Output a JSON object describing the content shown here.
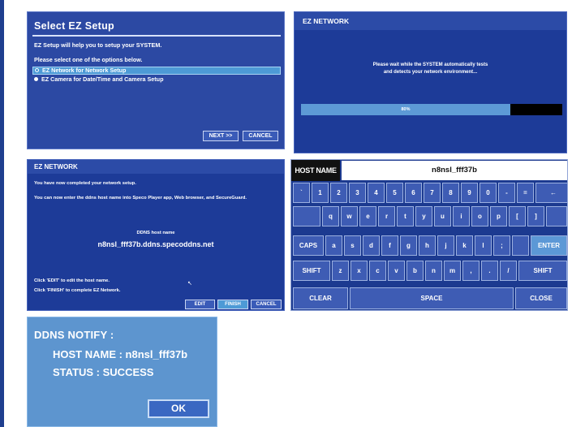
{
  "select_ez_setup": {
    "title": "Select EZ Setup",
    "desc1": "EZ Setup will help you to setup your SYSTEM.",
    "desc2": "Please select one of the options below.",
    "options": [
      {
        "label": "EZ Network for Network Setup",
        "selected": true
      },
      {
        "label": "EZ Camera for Date/Time and Camera Setup",
        "selected": false
      }
    ],
    "next_label": "NEXT >>",
    "cancel_label": "CANCEL"
  },
  "ez_network_progress": {
    "title": "EZ NETWORK",
    "wait_line1": "Please wait while the SYSTEM automatically tests",
    "wait_line2": "and detects your network environment...",
    "progress_label": "80%",
    "progress_value": 0.8
  },
  "ez_network_done": {
    "title": "EZ NETWORK",
    "line1": "You have now completed your network setup.",
    "line2": "You can now enter the ddns host name into Speco Player app, Web browser, and SecureGuard.",
    "ddns_label": "DDNS host name",
    "ddns_value": "n8nsl_fff37b.ddns.specoddns.net",
    "hint_edit": "Click 'EDIT' to edit the host name.",
    "hint_finish": "Click 'FINISH' to complete EZ Network.",
    "edit_label": "EDIT",
    "finish_label": "FINISH",
    "cancel_label": "CANCEL"
  },
  "keyboard": {
    "host_label": "HOST NAME",
    "host_value": "n8nsl_fff37b",
    "row1": [
      "`",
      "1",
      "2",
      "3",
      "4",
      "5",
      "6",
      "7",
      "8",
      "9",
      "0",
      "-",
      "=",
      "←"
    ],
    "row2": [
      "q",
      "w",
      "e",
      "r",
      "t",
      "y",
      "u",
      "i",
      "o",
      "p",
      "[",
      "]"
    ],
    "row3": [
      "CAPS",
      "a",
      "s",
      "d",
      "f",
      "g",
      "h",
      "j",
      "k",
      "l",
      ";",
      "",
      "ENTER"
    ],
    "row4": [
      "SHIFT",
      "z",
      "x",
      "c",
      "v",
      "b",
      "n",
      "m",
      ",",
      ".",
      "/",
      "SHIFT"
    ],
    "row5": [
      "CLEAR",
      "SPACE",
      "CLOSE"
    ],
    "icons": {
      "backspace": "left-arrow-icon"
    }
  },
  "ddns_notify": {
    "title": "DDNS NOTIFY :",
    "host_line": "HOST NAME : n8nsl_fff37b",
    "status_line": "STATUS : SUCCESS",
    "ok_label": "OK"
  }
}
